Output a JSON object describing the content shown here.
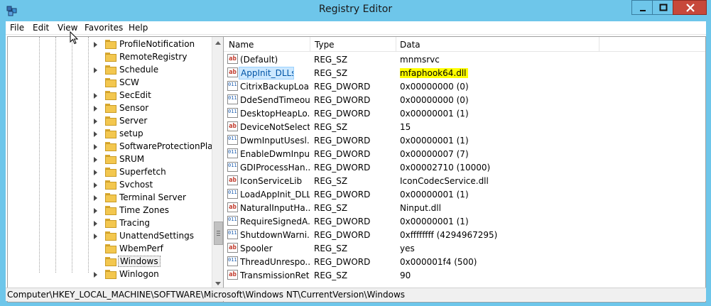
{
  "window": {
    "title": "Registry Editor"
  },
  "menu": [
    "File",
    "Edit",
    "View",
    "Favorites",
    "Help"
  ],
  "tree": {
    "items": [
      {
        "label": "ProfileNotification",
        "expandable": true
      },
      {
        "label": "RemoteRegistry",
        "expandable": false
      },
      {
        "label": "Schedule",
        "expandable": true
      },
      {
        "label": "SCW",
        "expandable": false
      },
      {
        "label": "SecEdit",
        "expandable": true
      },
      {
        "label": "Sensor",
        "expandable": true
      },
      {
        "label": "Server",
        "expandable": true
      },
      {
        "label": "setup",
        "expandable": true
      },
      {
        "label": "SoftwareProtectionPlatf",
        "expandable": true
      },
      {
        "label": "SRUM",
        "expandable": true
      },
      {
        "label": "Superfetch",
        "expandable": true
      },
      {
        "label": "Svchost",
        "expandable": true
      },
      {
        "label": "Terminal Server",
        "expandable": true
      },
      {
        "label": "Time Zones",
        "expandable": true
      },
      {
        "label": "Tracing",
        "expandable": true
      },
      {
        "label": "UnattendSettings",
        "expandable": true
      },
      {
        "label": "WbemPerf",
        "expandable": false
      },
      {
        "label": "Windows",
        "expandable": false,
        "selected": true
      },
      {
        "label": "Winlogon",
        "expandable": true
      }
    ]
  },
  "list": {
    "columns": [
      "Name",
      "Type",
      "Data"
    ],
    "rows": [
      {
        "name": "(Default)",
        "type": "REG_SZ",
        "data": "mnmsrvc",
        "kind": "sz"
      },
      {
        "name": "AppInit_DLLs",
        "type": "REG_SZ",
        "data": "mfaphook64.dll",
        "kind": "sz",
        "selected": true,
        "highlight": true
      },
      {
        "name": "CitrixBackupLoa...",
        "type": "REG_DWORD",
        "data": "0x00000000 (0)",
        "kind": "dword"
      },
      {
        "name": "DdeSendTimeout",
        "type": "REG_DWORD",
        "data": "0x00000000 (0)",
        "kind": "dword"
      },
      {
        "name": "DesktopHeapLo...",
        "type": "REG_DWORD",
        "data": "0x00000001 (1)",
        "kind": "dword"
      },
      {
        "name": "DeviceNotSelect...",
        "type": "REG_SZ",
        "data": "15",
        "kind": "sz"
      },
      {
        "name": "DwmInputUsesl...",
        "type": "REG_DWORD",
        "data": "0x00000001 (1)",
        "kind": "dword"
      },
      {
        "name": "EnableDwmInpu...",
        "type": "REG_DWORD",
        "data": "0x00000007 (7)",
        "kind": "dword"
      },
      {
        "name": "GDIProcessHan...",
        "type": "REG_DWORD",
        "data": "0x00002710 (10000)",
        "kind": "dword"
      },
      {
        "name": "IconServiceLib",
        "type": "REG_SZ",
        "data": "IconCodecService.dll",
        "kind": "sz"
      },
      {
        "name": "LoadAppInit_DLLs",
        "type": "REG_DWORD",
        "data": "0x00000001 (1)",
        "kind": "dword"
      },
      {
        "name": "NaturalInputHa...",
        "type": "REG_SZ",
        "data": "Ninput.dll",
        "kind": "sz"
      },
      {
        "name": "RequireSignedA...",
        "type": "REG_DWORD",
        "data": "0x00000001 (1)",
        "kind": "dword"
      },
      {
        "name": "ShutdownWarni...",
        "type": "REG_DWORD",
        "data": "0xffffffff (4294967295)",
        "kind": "dword"
      },
      {
        "name": "Spooler",
        "type": "REG_SZ",
        "data": "yes",
        "kind": "sz"
      },
      {
        "name": "ThreadUnrespo...",
        "type": "REG_DWORD",
        "data": "0x000001f4 (500)",
        "kind": "dword"
      },
      {
        "name": "TransmissionRet...",
        "type": "REG_SZ",
        "data": "90",
        "kind": "sz"
      }
    ]
  },
  "status": {
    "path": "Computer\\HKEY_LOCAL_MACHINE\\SOFTWARE\\Microsoft\\Windows NT\\CurrentVersion\\Windows"
  },
  "icons": {
    "sz": "ab",
    "dword": "0110",
    "app": "registry-icon"
  },
  "colors": {
    "titlebar": "#6ec6ea",
    "close": "#c7483a",
    "highlight": "#ffff00",
    "selection": "#cce8ff"
  }
}
